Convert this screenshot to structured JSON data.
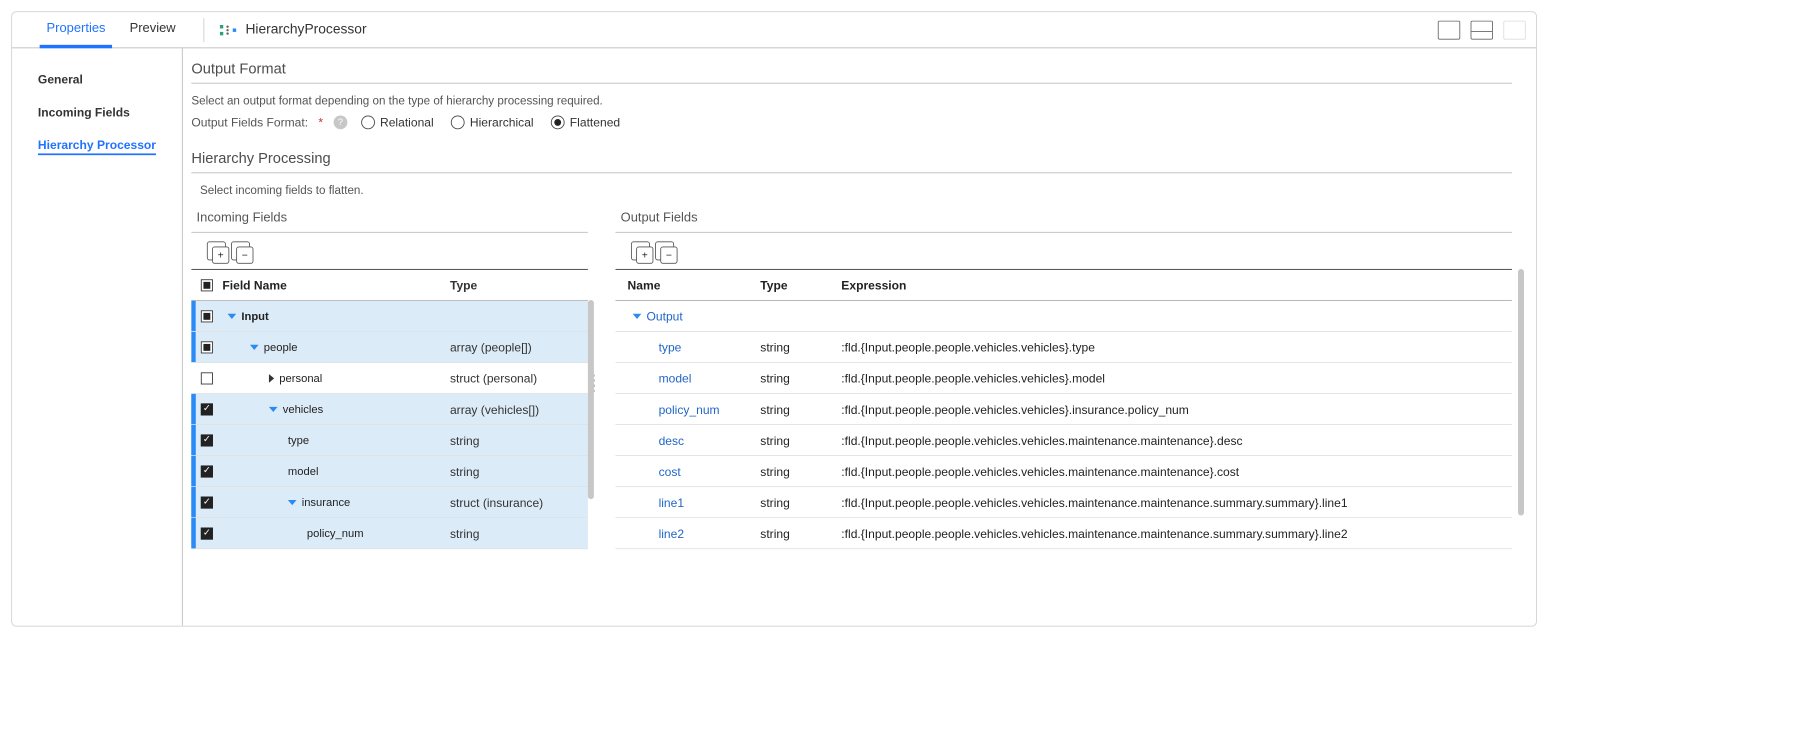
{
  "topTabs": {
    "properties": "Properties",
    "preview": "Preview"
  },
  "processorTitle": "HierarchyProcessor",
  "leftNav": {
    "general": "General",
    "incomingFields": "Incoming Fields",
    "hierarchyProcessor": "Hierarchy Processor"
  },
  "sections": {
    "outputFormat": {
      "title": "Output Format",
      "hint": "Select an output format depending on the type of hierarchy processing required.",
      "formatLabel": "Output Fields Format:",
      "options": {
        "relational": "Relational",
        "hierarchical": "Hierarchical",
        "flattened": "Flattened"
      }
    },
    "hierarchyProcessing": {
      "title": "Hierarchy Processing",
      "hint": "Select incoming fields to flatten."
    },
    "incomingFieldsPanel": {
      "title": "Incoming Fields"
    },
    "outputFieldsPanel": {
      "title": "Output Fields"
    }
  },
  "incomingHeaders": {
    "fieldName": "Field Name",
    "type": "Type"
  },
  "incomingRows": [
    {
      "check": "semi",
      "indent": 0,
      "exp": "down",
      "label": "Input",
      "bold": true,
      "type": "",
      "sel": true,
      "bars": 1
    },
    {
      "check": "semi",
      "indent": 1,
      "exp": "down",
      "label": "people",
      "type": "array (people[])",
      "sel": true,
      "bars": 1
    },
    {
      "check": "none",
      "indent": 2,
      "exp": "right",
      "label": "personal",
      "type": "struct (personal)",
      "sel": false,
      "bars": 0
    },
    {
      "check": "checked",
      "indent": 2,
      "exp": "down",
      "label": "vehicles",
      "type": "array (vehicles[])",
      "sel": true,
      "bars": 2
    },
    {
      "check": "checked",
      "indent": 3,
      "exp": null,
      "label": "type",
      "type": "string",
      "sel": true,
      "bars": 2
    },
    {
      "check": "checked",
      "indent": 3,
      "exp": null,
      "label": "model",
      "type": "string",
      "sel": true,
      "bars": 2
    },
    {
      "check": "checked",
      "indent": 3,
      "exp": "down",
      "label": "insurance",
      "type": "struct (insurance)",
      "sel": true,
      "bars": 2
    },
    {
      "check": "checked",
      "indent": 4,
      "exp": null,
      "label": "policy_num",
      "type": "string",
      "sel": true,
      "bars": 2
    }
  ],
  "outputHeaders": {
    "name": "Name",
    "type": "Type",
    "expression": "Expression"
  },
  "outputRootLabel": "Output",
  "outputRows": [
    {
      "name": "type",
      "type": "string",
      "expr": ":fld.{Input.people.people.vehicles.vehicles}.type"
    },
    {
      "name": "model",
      "type": "string",
      "expr": ":fld.{Input.people.people.vehicles.vehicles}.model"
    },
    {
      "name": "policy_num",
      "type": "string",
      "expr": ":fld.{Input.people.people.vehicles.vehicles}.insurance.policy_num"
    },
    {
      "name": "desc",
      "type": "string",
      "expr": ":fld.{Input.people.people.vehicles.vehicles.maintenance.maintenance}.desc"
    },
    {
      "name": "cost",
      "type": "string",
      "expr": ":fld.{Input.people.people.vehicles.vehicles.maintenance.maintenance}.cost"
    },
    {
      "name": "line1",
      "type": "string",
      "expr": ":fld.{Input.people.people.vehicles.vehicles.maintenance.maintenance.summary.summary}.line1"
    },
    {
      "name": "line2",
      "type": "string",
      "expr": ":fld.{Input.people.people.vehicles.vehicles.maintenance.maintenance.summary.summary}.line2"
    }
  ]
}
